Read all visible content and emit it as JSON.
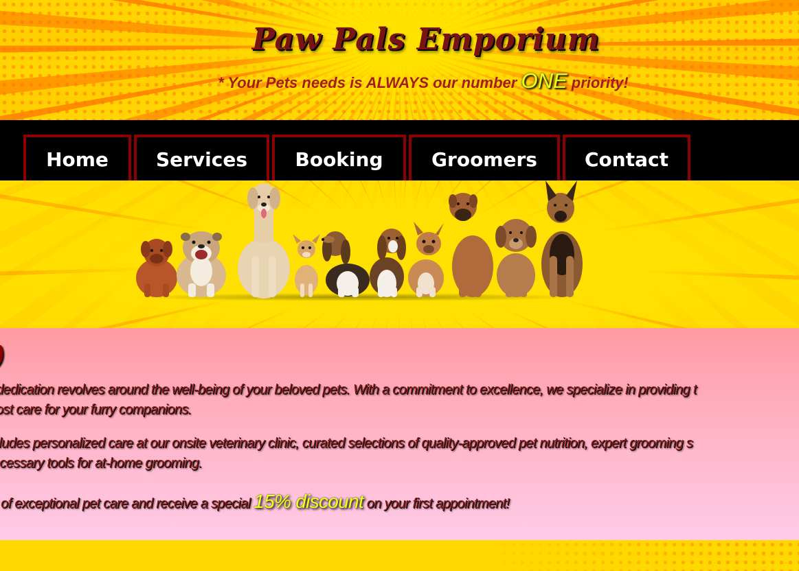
{
  "header": {
    "title": "Paw Pals Emporium",
    "tagline_before": "* Your Pets needs is ALWAYS our number ",
    "tagline_highlight": "ONE",
    "tagline_after": " priority!"
  },
  "nav": {
    "items": [
      {
        "label": "Home"
      },
      {
        "label": "Services"
      },
      {
        "label": "Booking"
      },
      {
        "label": "Groomers"
      },
      {
        "label": "Contact"
      }
    ]
  },
  "hero": {
    "image": "dogs-lineup-image"
  },
  "about": {
    "heading": ")",
    "p1_line1": "dedication revolves around the well-being of your beloved pets. With a commitment to excellence, we specialize in providing t",
    "p1_line2": "ost care for your furry companions.",
    "p2_line1": "cludes personalized care at our onsite veterinary clinic, curated selections of quality-approved pet nutrition, expert grooming s",
    "p2_line2": "ecessary tools for at-home grooming.",
    "p3_before": "y of exceptional pet care and receive a special ",
    "p3_highlight": "15% discount",
    "p3_after": " on your first appointment!"
  },
  "colors": {
    "title": "#7a1414",
    "tagline": "#a11f1f",
    "highlight": "#e8ff1a",
    "nav_bg": "#000000",
    "nav_border": "#8b0000",
    "nav_text": "#ffffff",
    "about_text": "#8a1c1c",
    "about_bg_top": "#ff9aa2",
    "about_bg_bottom": "#ffcbe8",
    "page_bg": "#ffd800"
  }
}
